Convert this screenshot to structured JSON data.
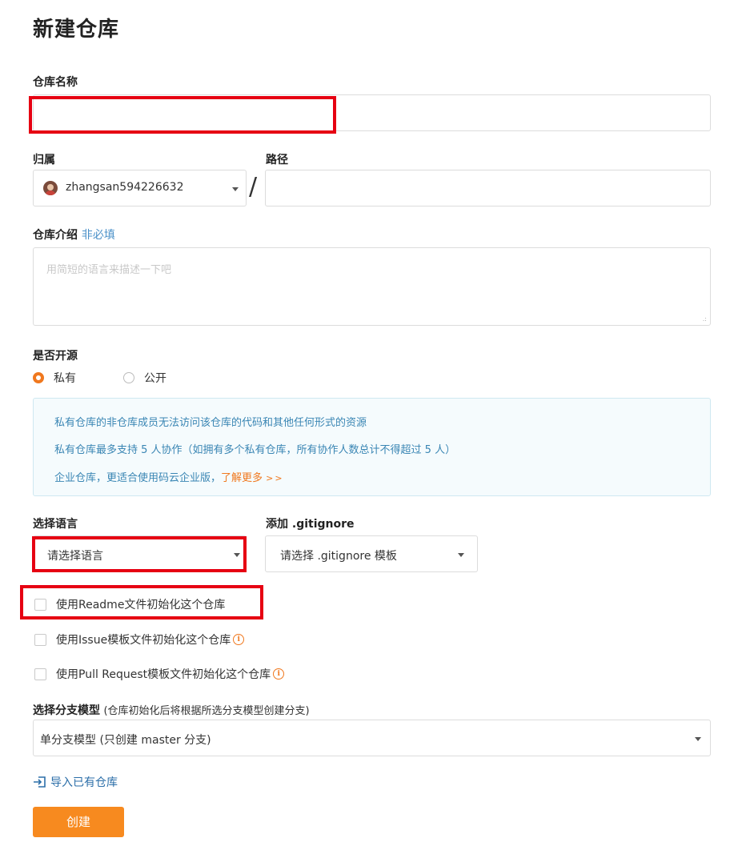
{
  "page": {
    "title": "新建仓库"
  },
  "form": {
    "repo_name": {
      "label": "仓库名称",
      "value": ""
    },
    "owner": {
      "label": "归属",
      "value": "zhangsan594226632",
      "separator": "/"
    },
    "path": {
      "label": "路径",
      "value": ""
    },
    "description": {
      "label": "仓库介绍",
      "optional_tag": "非必填",
      "placeholder": "用简短的语言来描述一下吧",
      "value": ""
    },
    "visibility": {
      "label": "是否开源",
      "options": [
        {
          "label": "私有",
          "selected": true
        },
        {
          "label": "公开",
          "selected": false
        }
      ]
    },
    "info": {
      "line1": "私有仓库的非仓库成员无法访问该仓库的代码和其他任何形式的资源",
      "line2": "私有仓库最多支持 5 人协作（如拥有多个私有仓库，所有协作人数总计不得超过 5 人）",
      "line3_prefix": "企业仓库，更适合使用码云企业版，",
      "line3_link": "了解更多",
      "line3_arrows": ">>"
    },
    "language": {
      "label": "选择语言",
      "value": "请选择语言"
    },
    "gitignore": {
      "label": "添加 .gitignore",
      "value": "请选择 .gitignore 模板"
    },
    "checkboxes": [
      {
        "label": "使用Readme文件初始化这个仓库",
        "checked": false,
        "info_icon": false
      },
      {
        "label": "使用Issue模板文件初始化这个仓库",
        "checked": false,
        "info_icon": true
      },
      {
        "label": "使用Pull Request模板文件初始化这个仓库",
        "checked": false,
        "info_icon": true
      }
    ],
    "branch_model": {
      "label": "选择分支模型",
      "hint": "(仓库初始化后将根据所选分支模型创建分支)",
      "value": "单分支模型 (只创建 master 分支)"
    },
    "import_link": "导入已有仓库",
    "submit_label": "创建"
  },
  "colors": {
    "accent": "#f78a1f",
    "highlight": "#e60012",
    "info_text": "#3a86b4"
  }
}
